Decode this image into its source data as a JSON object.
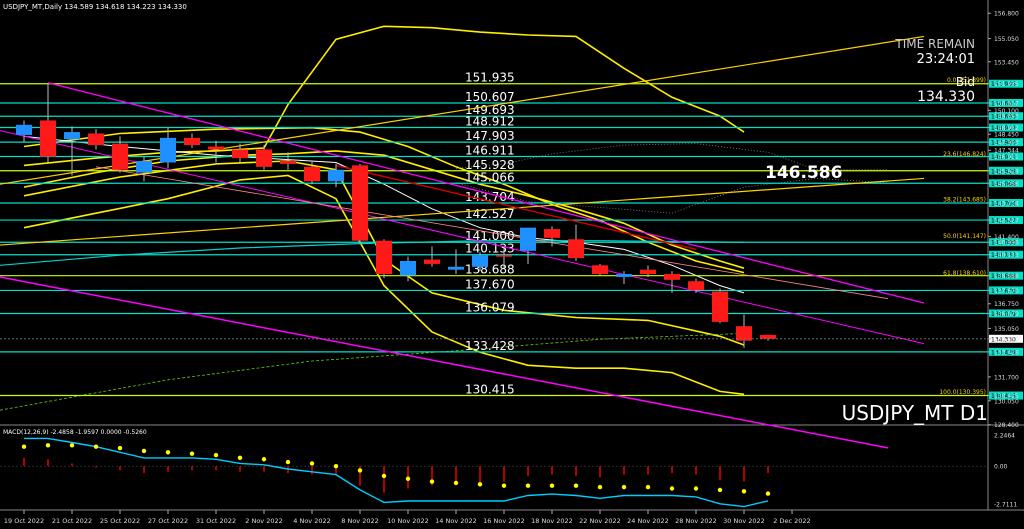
{
  "header": {
    "symbol_line": "USDJPY_MT,Daily  134.589 134.618 134.223 134.330"
  },
  "overlay": {
    "time_remain_label": "TIME REMAIN",
    "time_remain_value": "23:24:01",
    "bid_label": "Bid",
    "bid_value": "134.330",
    "big_value": "146.586",
    "symbol_tf": "USDJPY_MT D1"
  },
  "colors": {
    "bull": "#1e90ff",
    "bear": "#ff1a1a",
    "level": "#00e0c8",
    "yellow": "#ffee00",
    "magenta": "#ff00ff",
    "fib_green": "#c8ff00",
    "signal": "#ffff00",
    "macd_line": "#00ccff"
  },
  "chart_data": [
    {
      "type": "candlestick",
      "yaxis": {
        "range": [
          128.45,
          157.3
        ],
        "ticks": [
          "156.800",
          "155.050",
          "153.450",
          "151.935",
          "150.607",
          "150.100",
          "149.693",
          "148.912",
          "148.450",
          "147.903",
          "147.344",
          "146.911",
          "145.928",
          "145.066",
          "143.704",
          "142.527",
          "141.400",
          "140.996",
          "140.133",
          "138.688",
          "137.670",
          "136.750",
          "136.079",
          "135.050",
          "134.330",
          "133.428",
          "131.700",
          "130.415",
          "130.050",
          "128.400"
        ]
      },
      "xaxis_labels": [
        "19 Oct 2022",
        "21 Oct 2022",
        "25 Oct 2022",
        "27 Oct 2022",
        "31 Oct 2022",
        "2 Nov 2022",
        "4 Nov 2022",
        "8 Nov 2022",
        "10 Nov 2022",
        "14 Nov 2022",
        "16 Nov 2022",
        "18 Nov 2022",
        "22 Nov 2022",
        "24 Nov 2022",
        "28 Nov 2022",
        "30 Nov 2022",
        "2 Dec 2022"
      ],
      "candles": [
        {
          "o": 148.4,
          "h": 149.4,
          "l": 147.9,
          "c": 149.1
        },
        {
          "o": 149.4,
          "h": 151.9,
          "l": 146.5,
          "c": 146.9
        },
        {
          "o": 148.1,
          "h": 149.0,
          "l": 145.6,
          "c": 148.6
        },
        {
          "o": 148.5,
          "h": 148.8,
          "l": 147.4,
          "c": 147.7
        },
        {
          "o": 147.8,
          "h": 148.3,
          "l": 145.8,
          "c": 146.0
        },
        {
          "o": 145.8,
          "h": 146.9,
          "l": 145.2,
          "c": 146.6
        },
        {
          "o": 146.5,
          "h": 148.9,
          "l": 146.1,
          "c": 148.2
        },
        {
          "o": 148.2,
          "h": 148.5,
          "l": 147.5,
          "c": 147.7
        },
        {
          "o": 147.6,
          "h": 148.0,
          "l": 146.5,
          "c": 147.4
        },
        {
          "o": 147.4,
          "h": 147.8,
          "l": 146.5,
          "c": 146.8
        },
        {
          "o": 147.4,
          "h": 147.7,
          "l": 146.0,
          "c": 146.2
        },
        {
          "o": 146.6,
          "h": 147.2,
          "l": 146.0,
          "c": 146.4
        },
        {
          "o": 146.2,
          "h": 146.6,
          "l": 145.0,
          "c": 145.2
        },
        {
          "o": 145.2,
          "h": 146.4,
          "l": 144.8,
          "c": 146.0
        },
        {
          "o": 146.3,
          "h": 146.4,
          "l": 140.9,
          "c": 141.1
        },
        {
          "o": 141.1,
          "h": 141.2,
          "l": 138.5,
          "c": 138.8
        },
        {
          "o": 138.7,
          "h": 140.0,
          "l": 138.3,
          "c": 139.7
        },
        {
          "o": 139.8,
          "h": 140.7,
          "l": 139.3,
          "c": 139.5
        },
        {
          "o": 139.1,
          "h": 140.5,
          "l": 138.8,
          "c": 139.3
        },
        {
          "o": 139.3,
          "h": 140.3,
          "l": 139.0,
          "c": 140.1
        },
        {
          "o": 140.1,
          "h": 140.6,
          "l": 139.2,
          "c": 140.0
        },
        {
          "o": 140.4,
          "h": 142.0,
          "l": 139.5,
          "c": 142.0
        },
        {
          "o": 141.9,
          "h": 142.1,
          "l": 140.7,
          "c": 141.3
        },
        {
          "o": 141.2,
          "h": 142.2,
          "l": 139.7,
          "c": 139.9
        },
        {
          "o": 139.4,
          "h": 139.5,
          "l": 138.7,
          "c": 138.8
        },
        {
          "o": 138.6,
          "h": 139.0,
          "l": 138.1,
          "c": 138.8
        },
        {
          "o": 139.1,
          "h": 139.4,
          "l": 138.6,
          "c": 138.8
        },
        {
          "o": 138.8,
          "h": 139.0,
          "l": 137.5,
          "c": 138.4
        },
        {
          "o": 138.3,
          "h": 138.5,
          "l": 137.5,
          "c": 137.7
        },
        {
          "o": 137.6,
          "h": 137.8,
          "l": 135.4,
          "c": 135.5
        },
        {
          "o": 135.2,
          "h": 136.0,
          "l": 133.7,
          "c": 134.2
        },
        {
          "o": 134.6,
          "h": 134.6,
          "l": 134.2,
          "c": 134.33
        }
      ],
      "levels": [
        {
          "value": 151.935,
          "label": "151.935",
          "left": true
        },
        {
          "value": 150.607,
          "label": "150.607",
          "left": true
        },
        {
          "value": 149.693,
          "label": "149.693",
          "left": true
        },
        {
          "value": 148.912,
          "label": "148.912",
          "left": true
        },
        {
          "value": 147.903,
          "label": "147.903",
          "left": true
        },
        {
          "value": 146.911,
          "label": "146.911",
          "left": true
        },
        {
          "value": 145.928,
          "label": "145.928",
          "left": true
        },
        {
          "value": 145.066,
          "label": "145.066",
          "left": true
        },
        {
          "value": 143.704,
          "label": "143.704",
          "left": true
        },
        {
          "value": 142.527,
          "label": "142.527",
          "left": true
        },
        {
          "value": 140.996,
          "label": "141.000",
          "left": true
        },
        {
          "value": 140.133,
          "label": "140.133",
          "left": true
        },
        {
          "value": 138.688,
          "label": "138.688",
          "left": true
        },
        {
          "value": 137.67,
          "label": "137.670",
          "left": true
        },
        {
          "value": 136.079,
          "label": "136.079",
          "left": true
        },
        {
          "value": 133.428,
          "label": "133.428",
          "left": true
        },
        {
          "value": 130.415,
          "label": "130.415",
          "left": true
        }
      ],
      "fib_levels": [
        {
          "value": 151.9,
          "label": "0.0(151.899)"
        },
        {
          "value": 146.824,
          "label": "23.6(146.824)"
        },
        {
          "value": 143.685,
          "label": "38.2(143.685)"
        },
        {
          "value": 141.147,
          "label": "50.0(141.147)"
        },
        {
          "value": 138.61,
          "label": "61.8(138.610)"
        },
        {
          "value": 130.395,
          "label": "100.0(130.395)"
        }
      ],
      "current_price": 134.33
    },
    {
      "type": "bar",
      "title": "MACD(12,26,9) -2.4858 -1.9597 0.0000 -0.5260",
      "ylim": [
        -3.0,
        2.6
      ],
      "ticks": [
        "2.2464",
        "0.00",
        "-2.7111"
      ],
      "histogram": [
        0.6,
        0.5,
        0.2,
        -0.1,
        -0.3,
        -0.5,
        -0.4,
        -0.3,
        -0.3,
        -0.4,
        -0.4,
        -0.5,
        -0.6,
        -0.6,
        -1.4,
        -1.9,
        -1.6,
        -1.4,
        -1.3,
        -1.2,
        -1.1,
        -0.7,
        -0.6,
        -0.7,
        -0.8,
        -0.6,
        -0.6,
        -0.5,
        -0.6,
        -1.0,
        -1.1,
        -0.5
      ],
      "signal": [
        1.4,
        1.5,
        1.5,
        1.4,
        1.3,
        1.1,
        1.0,
        0.9,
        0.8,
        0.6,
        0.5,
        0.3,
        0.2,
        0.0,
        -0.3,
        -0.7,
        -0.9,
        -1.1,
        -1.2,
        -1.3,
        -1.4,
        -1.4,
        -1.4,
        -1.4,
        -1.5,
        -1.5,
        -1.5,
        -1.6,
        -1.6,
        -1.7,
        -1.8,
        -1.96
      ],
      "macd": [
        2.0,
        2.0,
        1.7,
        1.4,
        1.0,
        0.6,
        0.6,
        0.6,
        0.5,
        0.2,
        0.1,
        -0.2,
        -0.4,
        -0.6,
        -1.7,
        -2.6,
        -2.5,
        -2.5,
        -2.5,
        -2.5,
        -2.5,
        -2.1,
        -2.0,
        -2.1,
        -2.3,
        -2.1,
        -2.1,
        -2.1,
        -2.2,
        -2.7,
        -2.9,
        -2.49
      ]
    }
  ]
}
